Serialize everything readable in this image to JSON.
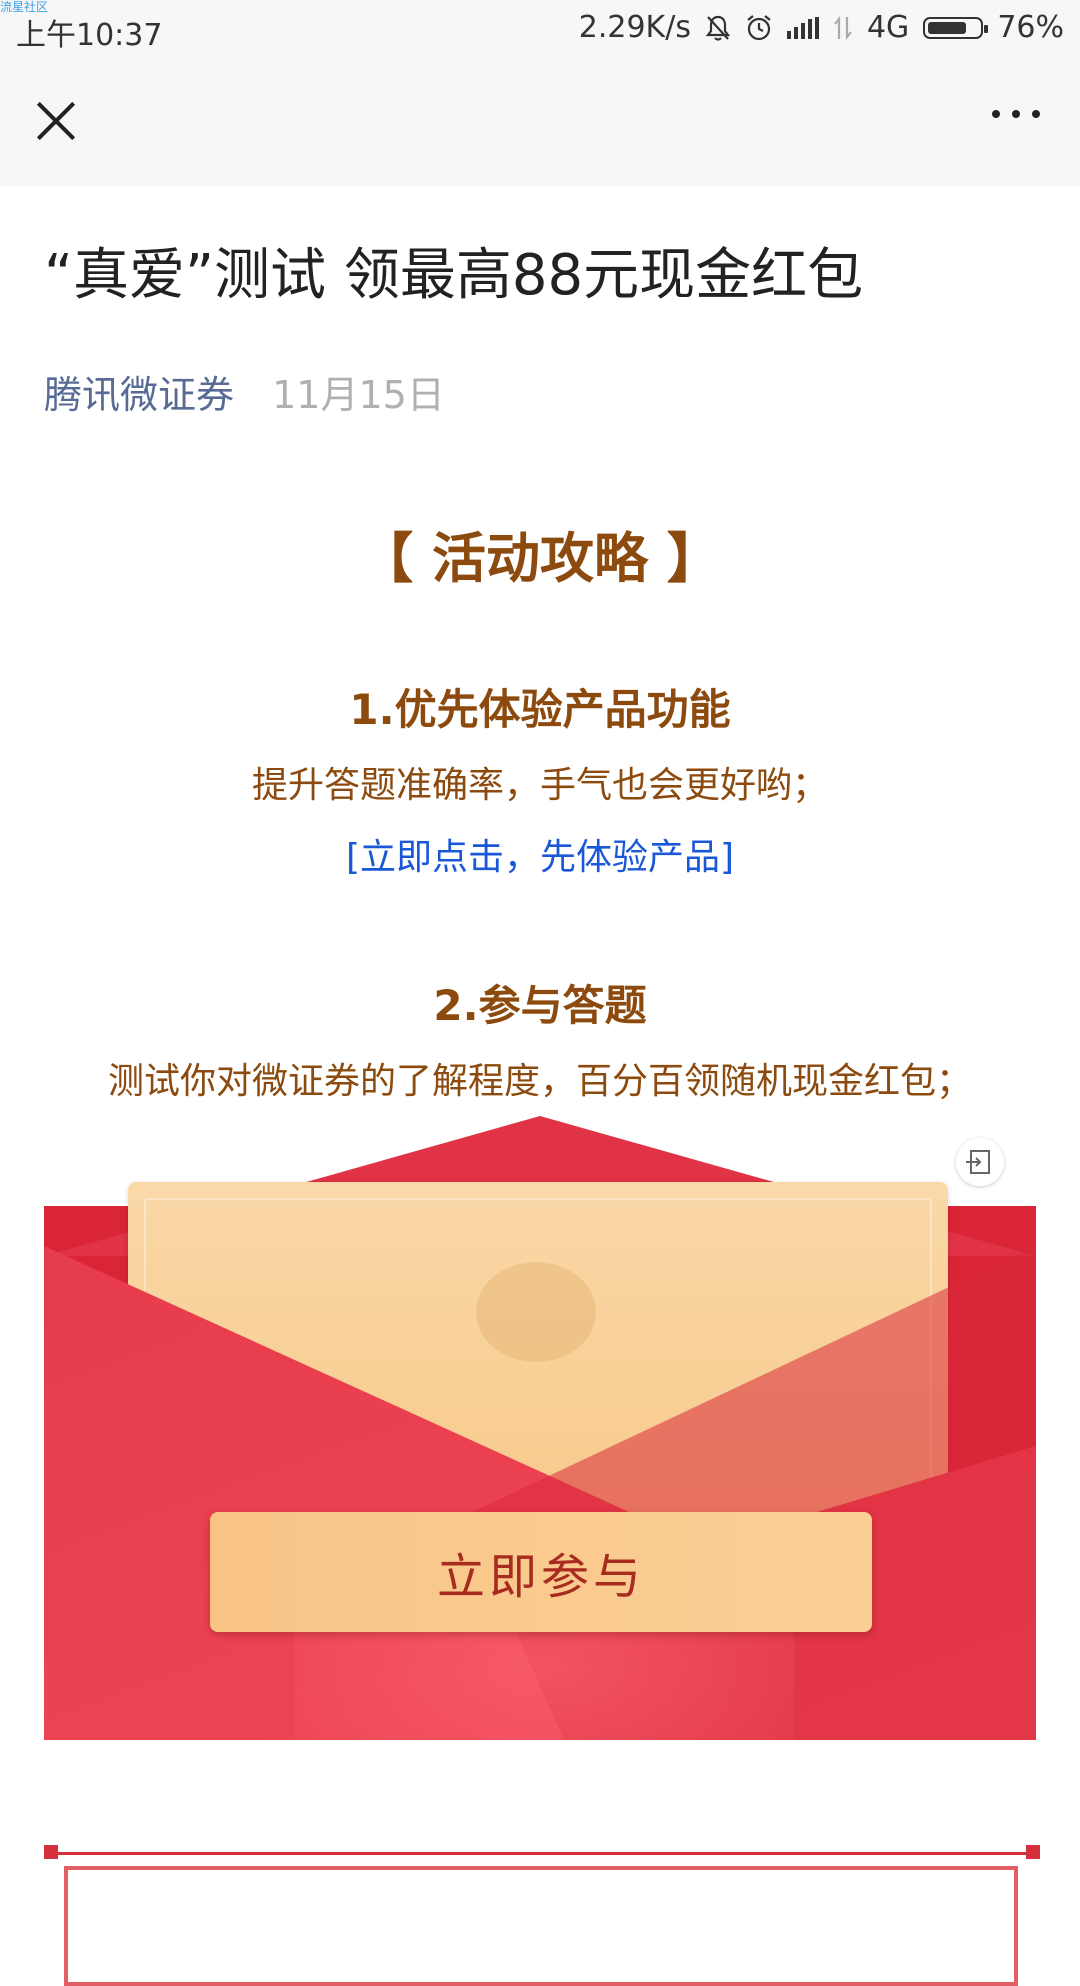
{
  "status_bar": {
    "watermark": "流星社区",
    "time": "上午10:37",
    "net_speed": "2.29K/s",
    "network": "4G",
    "battery": "76%",
    "battery_level": 0.76
  },
  "nav": {
    "close_icon": "close-icon",
    "more_icon": "more-icon"
  },
  "article": {
    "title": "“真爱”测试 领最高88元现金红包",
    "author": "腾讯微证券",
    "date": "11月15日",
    "guide_heading": "【 活动攻略 】",
    "step1_title": "1.优先体验产品功能",
    "step1_desc": "提升答题准确率，手气也会更好哟；",
    "step1_link": "[立即点击，先体验产品]",
    "step2_title": "2.参与答题",
    "step2_desc": "测试你对微证券的了解程度，百分百领随机现金红包；",
    "join_button": "立即参与"
  },
  "colors": {
    "accent_gold": "#8c4a0e",
    "link_blue": "#1b58d8",
    "author_blue": "#576b95",
    "envelope_red": "#e03345"
  }
}
